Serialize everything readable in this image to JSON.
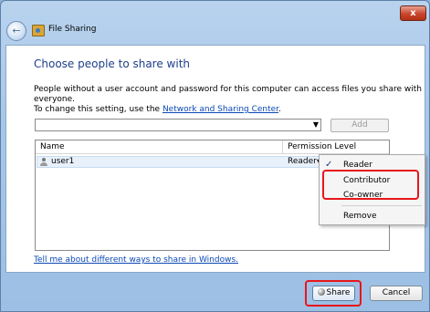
{
  "window": {
    "title": "File Sharing",
    "close_glyph": "x",
    "back_glyph": "←"
  },
  "main": {
    "heading": "Choose people to share with",
    "description_line1": "People without a user account and password for this computer can access files you share with everyone.",
    "description_line2_prefix": "To change this setting, use the ",
    "description_link": "Network and Sharing Center",
    "description_line2_suffix": ".",
    "combo_value": "",
    "combo_arrow": "▼",
    "add_label": "Add",
    "table": {
      "columns": [
        "Name",
        "Permission Level"
      ],
      "rows": [
        {
          "name": "user1",
          "permission": "Reader",
          "arrow": "▼"
        }
      ]
    },
    "help_link": "Tell me about different ways to share in Windows."
  },
  "permission_menu": {
    "checkmark": "✓",
    "items": [
      "Reader",
      "Contributor",
      "Co-owner",
      "Remove"
    ],
    "selected": "Reader"
  },
  "footer": {
    "share_label": "Share",
    "cancel_label": "Cancel"
  },
  "colors": {
    "highlight": "#e8161b",
    "heading": "#1e3f8a",
    "link": "#0b48b5"
  }
}
